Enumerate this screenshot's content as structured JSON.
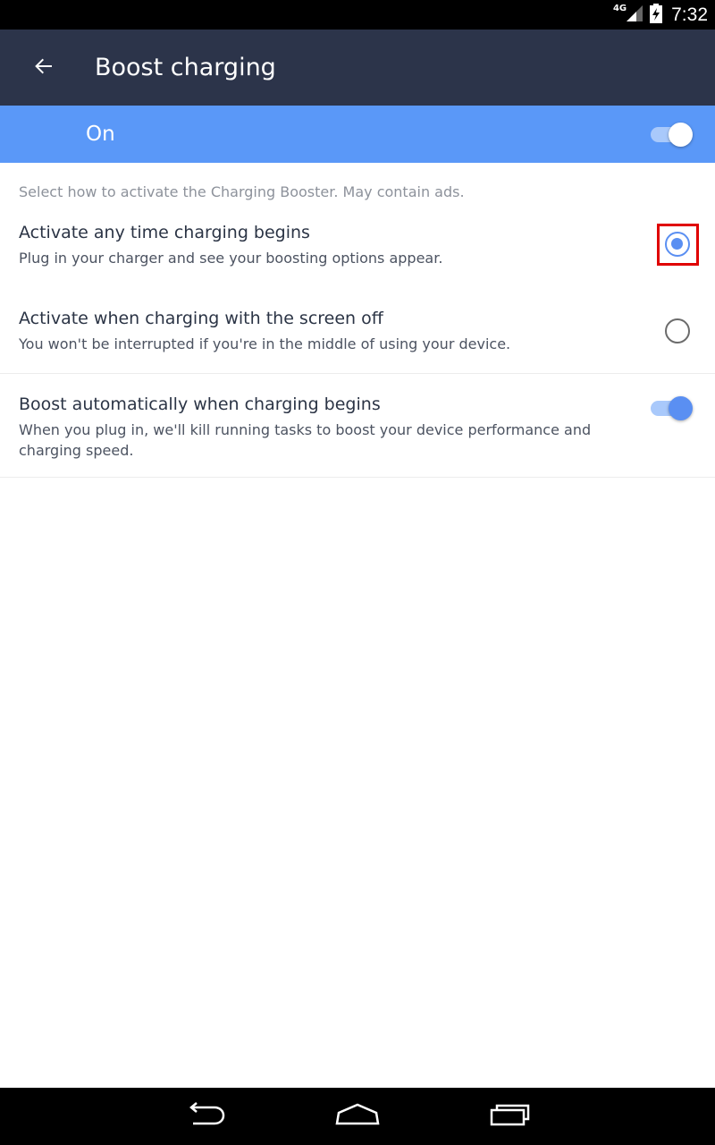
{
  "status_bar": {
    "network": "4G",
    "time": "7:32",
    "icons": [
      "signal-icon",
      "battery-charging-icon"
    ]
  },
  "app_bar": {
    "title": "Boost charging",
    "back_icon": "arrow-left-icon"
  },
  "master_toggle": {
    "label": "On",
    "enabled": true
  },
  "hint": "Select how to activate the Charging Booster. May contain ads.",
  "options": [
    {
      "title": "Activate any time charging begins",
      "description": "Plug in your charger and see your boosting options appear.",
      "selected": true
    },
    {
      "title": "Activate when charging with the screen off",
      "description": "You won't be interrupted if you're in the middle of using your device.",
      "selected": false
    }
  ],
  "auto_boost": {
    "title": "Boost automatically when charging begins",
    "description": "When you plug in, we'll kill running tasks to boost your device performance and charging speed.",
    "enabled": true
  },
  "nav_bar": {
    "buttons": [
      "back-icon",
      "home-icon",
      "recents-icon"
    ]
  },
  "colors": {
    "app_bar": "#2c344a",
    "accent": "#5a98f8",
    "radio_active": "#5a8ff2",
    "highlight": "#e00000"
  }
}
